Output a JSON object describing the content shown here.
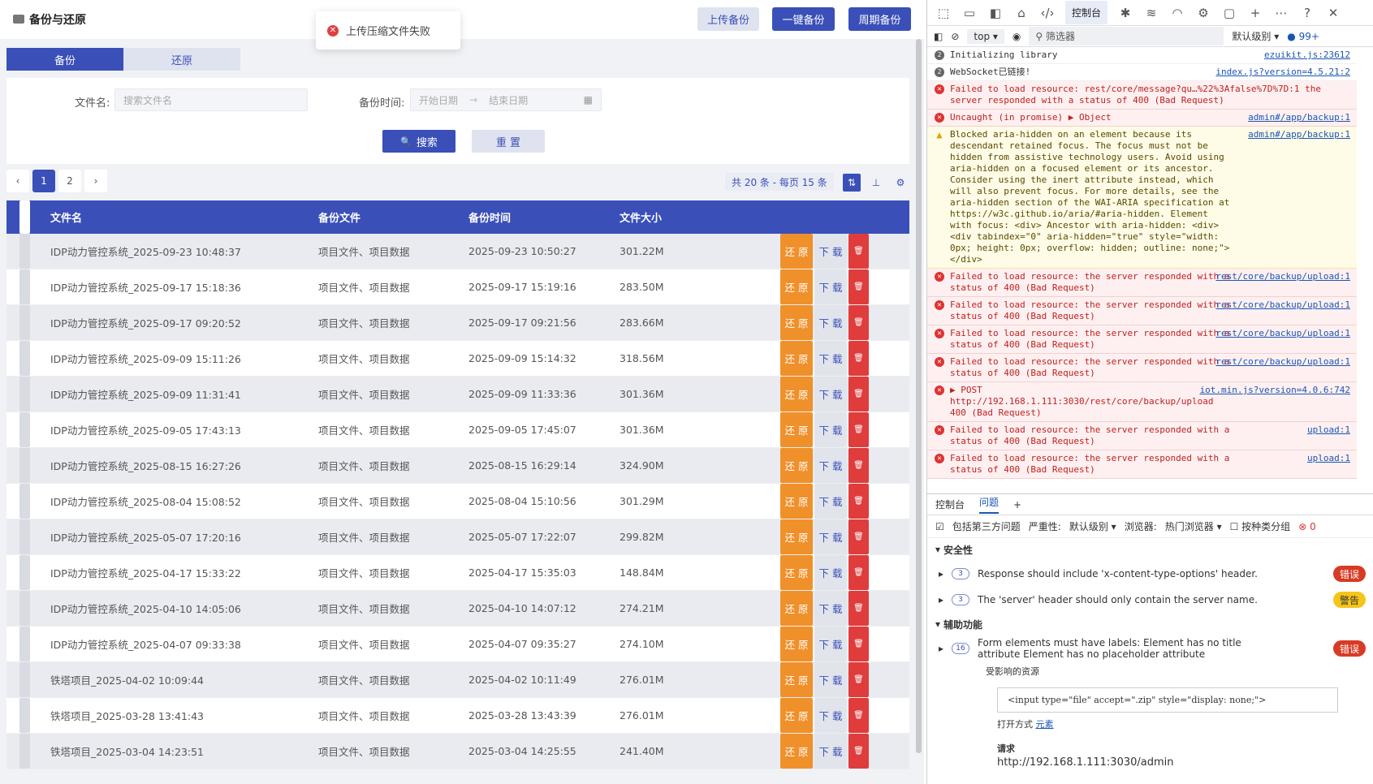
{
  "app": {
    "title": "备份与还原",
    "buttons": {
      "upload": "上传备份",
      "one_click": "一键备份",
      "periodic": "周期备份"
    },
    "toast": "上传压缩文件失败",
    "tabs": [
      "备份",
      "还原"
    ],
    "search": {
      "name_label": "文件名:",
      "name_placeholder": "搜索文件名",
      "time_label": "备份时间:",
      "start_placeholder": "开始日期",
      "end_placeholder": "结束日期",
      "search_btn": "搜索",
      "reset_btn": "重 置"
    },
    "pagination": {
      "pages": [
        "1",
        "2"
      ],
      "current": "1",
      "summary": "共 20 条 - 每页 15 条"
    },
    "table": {
      "headers": [
        "文件名",
        "备份文件",
        "备份时间",
        "文件大小"
      ],
      "actions": {
        "restore": "还 原",
        "download": "下 载"
      },
      "rows": [
        [
          "IDP动力管控系统_2025-09-23 10:48:37",
          "项目文件、项目数据",
          "2025-09-23 10:50:27",
          "301.22M"
        ],
        [
          "IDP动力管控系统_2025-09-17 15:18:36",
          "项目文件、项目数据",
          "2025-09-17 15:19:16",
          "283.50M"
        ],
        [
          "IDP动力管控系统_2025-09-17 09:20:52",
          "项目文件、项目数据",
          "2025-09-17 09:21:56",
          "283.66M"
        ],
        [
          "IDP动力管控系统_2025-09-09 15:11:26",
          "项目文件、项目数据",
          "2025-09-09 15:14:32",
          "318.56M"
        ],
        [
          "IDP动力管控系统_2025-09-09 11:31:41",
          "项目文件、项目数据",
          "2025-09-09 11:33:36",
          "301.36M"
        ],
        [
          "IDP动力管控系统_2025-09-05 17:43:13",
          "项目文件、项目数据",
          "2025-09-05 17:45:07",
          "301.36M"
        ],
        [
          "IDP动力管控系统_2025-08-15 16:27:26",
          "项目文件、项目数据",
          "2025-08-15 16:29:14",
          "324.90M"
        ],
        [
          "IDP动力管控系统_2025-08-04 15:08:52",
          "项目文件、项目数据",
          "2025-08-04 15:10:56",
          "301.29M"
        ],
        [
          "IDP动力管控系统_2025-05-07 17:20:16",
          "项目文件、项目数据",
          "2025-05-07 17:22:07",
          "299.82M"
        ],
        [
          "IDP动力管控系统_2025-04-17 15:33:22",
          "项目文件、项目数据",
          "2025-04-17 15:35:03",
          "148.84M"
        ],
        [
          "IDP动力管控系统_2025-04-10 14:05:06",
          "项目文件、项目数据",
          "2025-04-10 14:07:12",
          "274.21M"
        ],
        [
          "IDP动力管控系统_2025-04-07 09:33:38",
          "项目文件、项目数据",
          "2025-04-07 09:35:27",
          "274.10M"
        ],
        [
          "铁塔项目_2025-04-02 10:09:44",
          "项目文件、项目数据",
          "2025-04-02 10:11:49",
          "276.01M"
        ],
        [
          "铁塔项目_2025-03-28 13:41:43",
          "项目文件、项目数据",
          "2025-03-28 13:43:39",
          "276.01M"
        ],
        [
          "铁塔项目_2025-03-04 14:23:51",
          "项目文件、项目数据",
          "2025-03-04 14:25:55",
          "241.40M"
        ]
      ]
    }
  },
  "devtools": {
    "console_tab": "控制台",
    "badge": "99+",
    "context": "top",
    "filter_placeholder": "筛选器",
    "level": "默认级别",
    "logs": [
      {
        "type": "info",
        "text": "Initializing library",
        "src": "ezuikit.js:23612"
      },
      {
        "type": "info",
        "text": "WebSocket已链接!",
        "src": "index.js?version=4.5.21:2"
      },
      {
        "type": "error",
        "text": "Failed to load resource: rest/core/message?qu…%22%3Afalse%7D%7D:1 the server responded with a status of 400 (Bad Request)",
        "src": ""
      },
      {
        "type": "error",
        "text": "Uncaught (in promise) ▶ Object",
        "src": "admin#/app/backup:1"
      },
      {
        "type": "warn",
        "text": "Blocked aria-hidden on an element because its descendant retained focus. The focus must not be hidden from assistive technology users. Avoid using aria-hidden on a focused element or its ancestor. Consider using the inert attribute instead, which will also prevent focus. For more details, see the aria-hidden section of the WAI-ARIA specification at https://w3c.github.io/aria/#aria-hidden. Element with focus: <div> Ancestor with aria-hidden: <div> <div tabindex=\"0\" aria-hidden=\"true\" style=\"width: 0px; height: 0px; overflow: hidden; outline: none;\"></div>",
        "src": "admin#/app/backup:1"
      },
      {
        "type": "error",
        "text": "Failed to load resource: the server responded with a status of 400 (Bad Request)",
        "src": "rest/core/backup/upload:1"
      },
      {
        "type": "error",
        "text": "Failed to load resource: the server responded with a status of 400 (Bad Request)",
        "src": "rest/core/backup/upload:1"
      },
      {
        "type": "error",
        "text": "Failed to load resource: the server responded with a status of 400 (Bad Request)",
        "src": "rest/core/backup/upload:1"
      },
      {
        "type": "error",
        "text": "Failed to load resource: the server responded with a status of 400 (Bad Request)",
        "src": "rest/core/backup/upload:1"
      },
      {
        "type": "error",
        "text": "▶ POST http://192.168.1.111:3030/rest/core/backup/upload 400 (Bad Request)",
        "src": "iot.min.js?version=4.0.6:742"
      },
      {
        "type": "error",
        "text": "Failed to load resource: the server responded with a status of 400 (Bad Request)",
        "src": "upload:1"
      },
      {
        "type": "error",
        "text": "Failed to load resource: the server responded with a status of 400 (Bad Request)",
        "src": "upload:1"
      }
    ],
    "bottom": {
      "tabs": [
        "控制台",
        "问题"
      ],
      "options": {
        "third_party": "包括第三方问题",
        "severity": "严重性:",
        "severity_val": "默认级别",
        "browser": "浏览器:",
        "browser_val": "热门浏览器",
        "group": "按种类分组",
        "err_count": "0"
      },
      "sections": [
        {
          "title": "安全性",
          "issues": [
            {
              "count": "3",
              "text": "Response should include 'x-content-type-options' header.",
              "tag": "错误",
              "level": "err"
            },
            {
              "count": "3",
              "text": "The 'server' header should only contain the server name.",
              "tag": "警告",
              "level": "wr"
            }
          ]
        },
        {
          "title": "辅助功能",
          "issues": [
            {
              "count": "16",
              "text": "Form elements must have labels: Element has no title attribute Element has no placeholder attribute",
              "tag": "错误",
              "level": "err"
            }
          ]
        }
      ],
      "affected": "受影响的资源",
      "snippet": "<input type=\"file\" accept=\".zip\" style=\"display: none;\">",
      "open_with": "打开方式",
      "element_link": "元素",
      "request": "请求",
      "request_url": "http://192.168.1.111:3030/admin"
    }
  },
  "colors": {
    "brand": "#3a4fb8",
    "restore": "#f0902a",
    "delete": "#e03c3c"
  }
}
